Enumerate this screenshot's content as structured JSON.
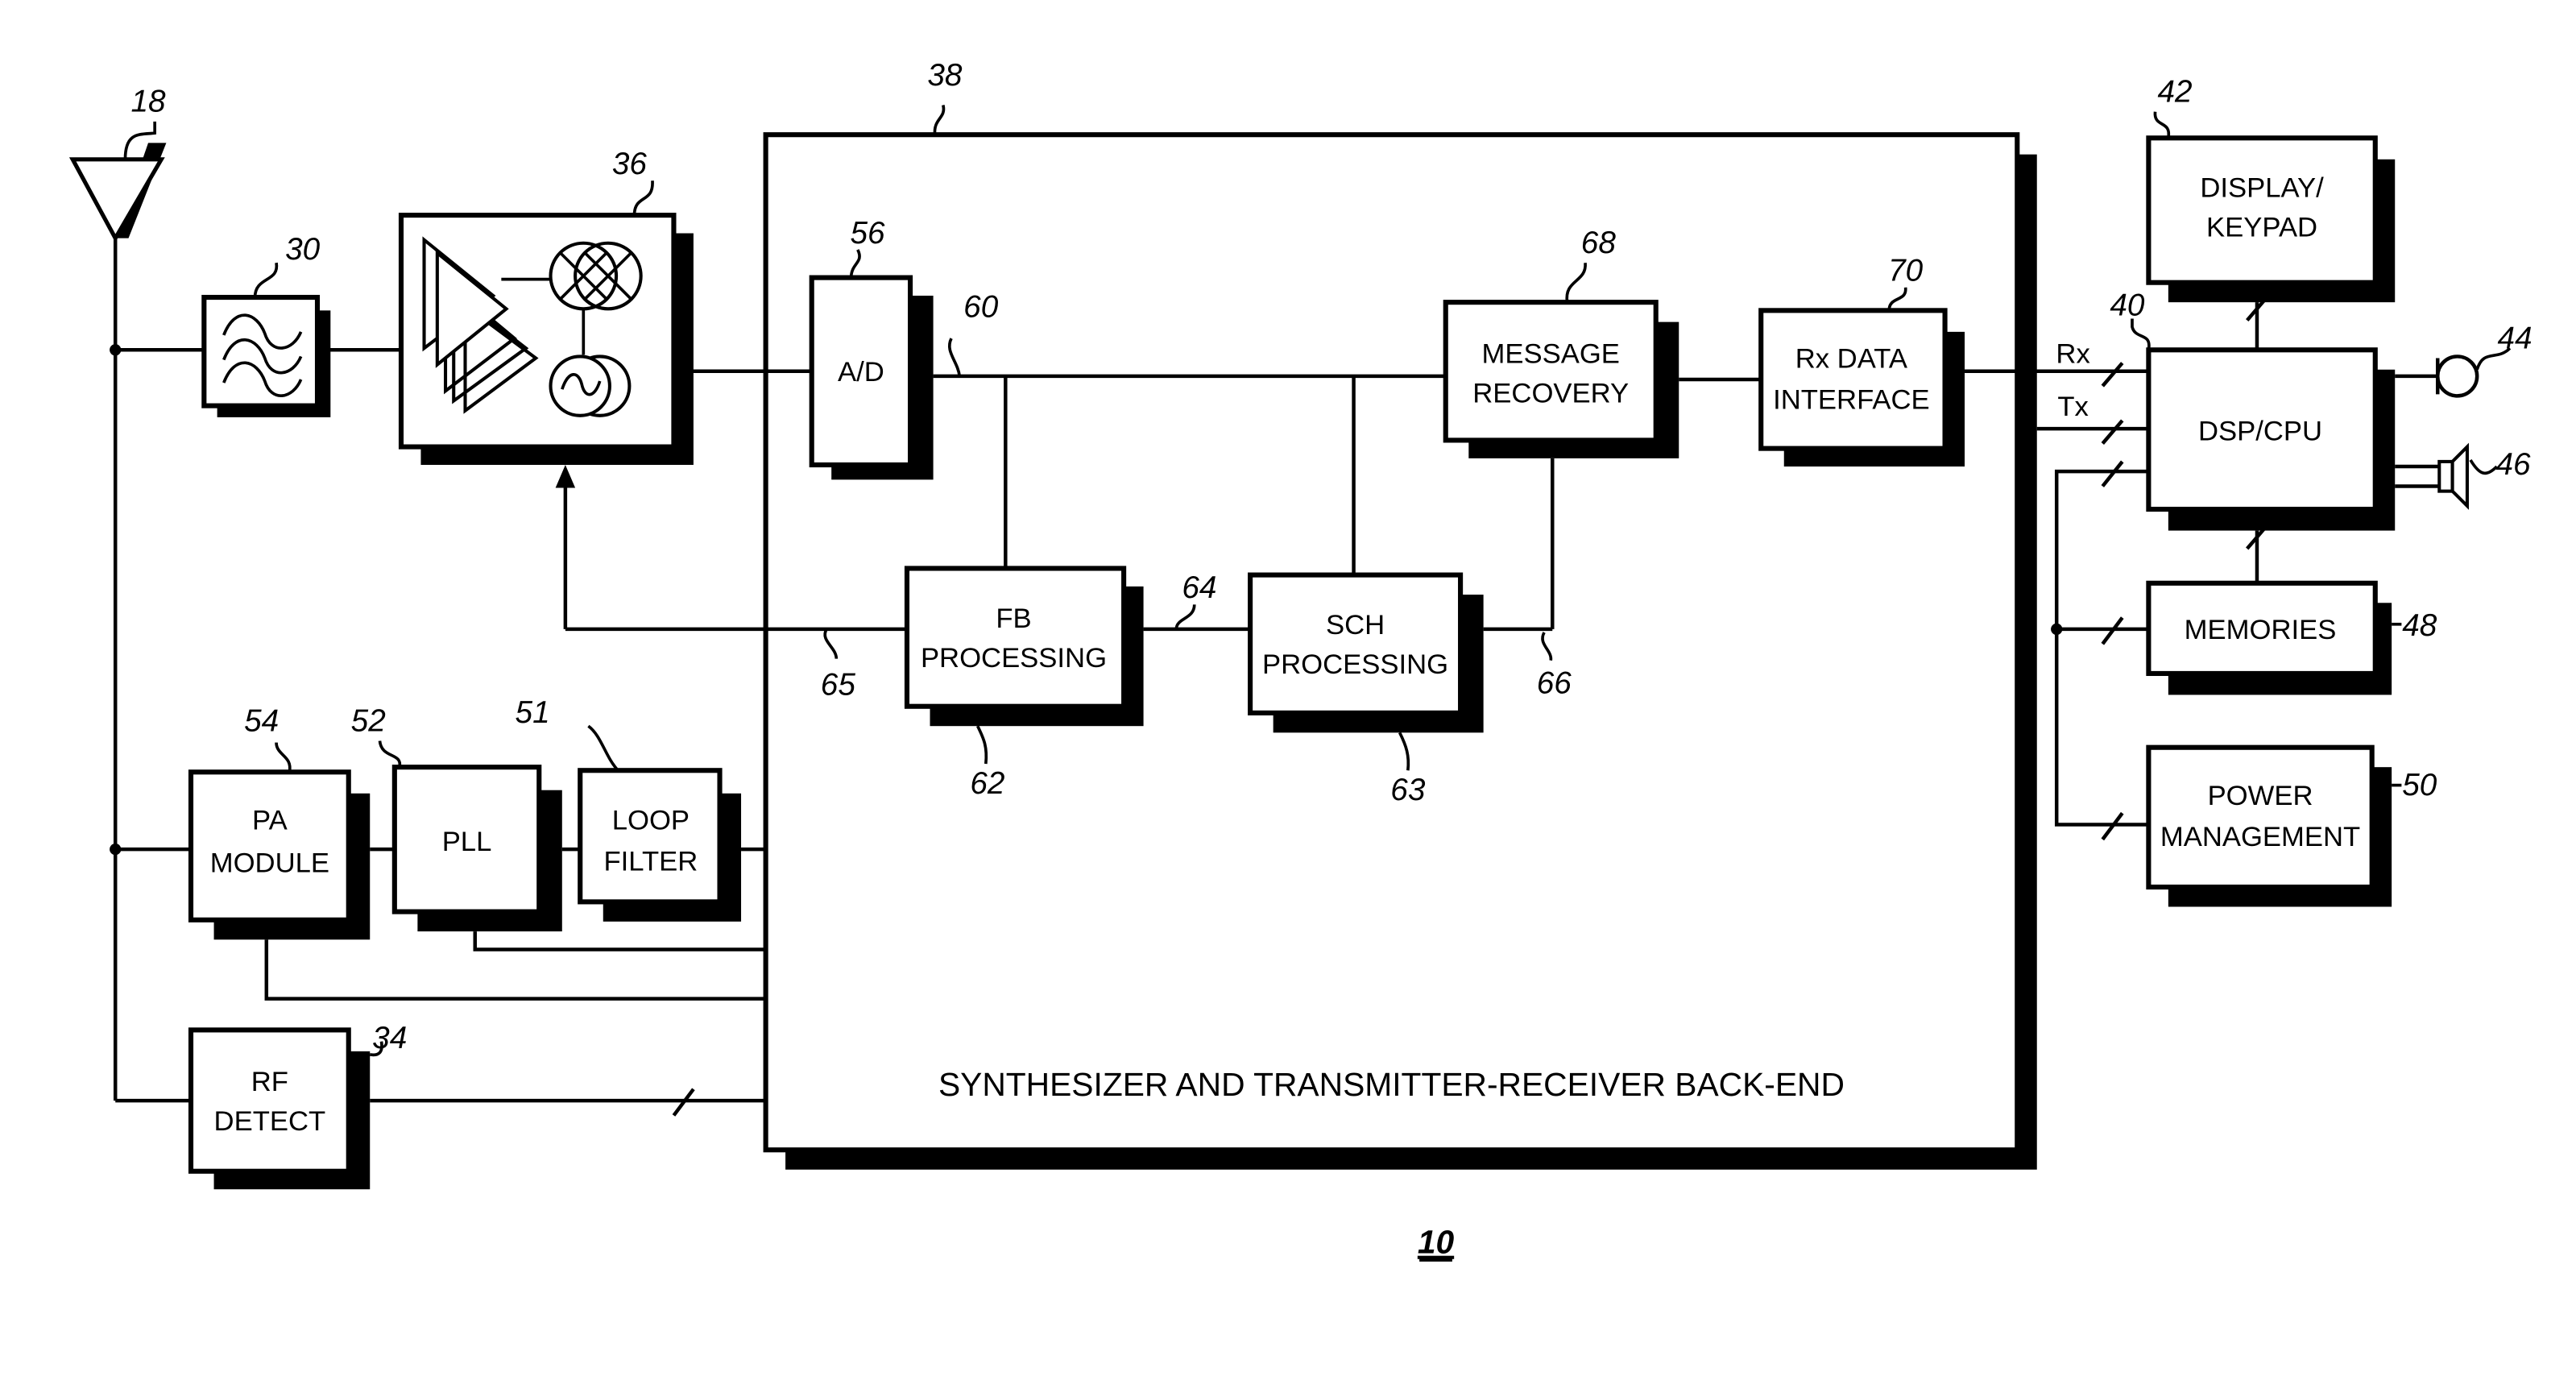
{
  "diagram": {
    "figure_number": "10",
    "colors": {
      "ink": "#000000",
      "background": "#ffffff"
    },
    "blocks": {
      "antenna": {
        "ref": "18",
        "icon": "antenna-icon"
      },
      "filter": {
        "ref": "30",
        "icon": "bandpass-filter-icon"
      },
      "rf_frontend": {
        "ref": "36",
        "icon": "amplifier-mixer-oscillator-icon"
      },
      "backend": {
        "ref": "38",
        "label": "SYNTHESIZER AND TRANSMITTER-RECEIVER BACK-END"
      },
      "adc": {
        "ref": "56",
        "label": "A/D"
      },
      "message_recovery": {
        "ref": "68",
        "line1": "MESSAGE",
        "line2": "RECOVERY"
      },
      "rx_data_interface": {
        "ref": "70",
        "line1": "Rx DATA",
        "line2": "INTERFACE"
      },
      "fb_processing": {
        "ref": "62",
        "line1": "FB",
        "line2": "PROCESSING"
      },
      "sch_processing": {
        "ref": "63",
        "line1": "SCH",
        "line2": "PROCESSING"
      },
      "dsp_cpu": {
        "ref": "40",
        "label": "DSP/CPU"
      },
      "display_keypad": {
        "ref": "42",
        "line1": "DISPLAY/",
        "line2": "KEYPAD"
      },
      "microphone": {
        "ref": "44",
        "icon": "microphone-icon"
      },
      "speaker": {
        "ref": "46",
        "icon": "speaker-icon"
      },
      "memories": {
        "ref": "48",
        "label": "MEMORIES"
      },
      "power_management": {
        "ref": "50",
        "line1": "POWER",
        "line2": "MANAGEMENT"
      },
      "pa_module": {
        "ref": "54",
        "line1": "PA",
        "line2": "MODULE"
      },
      "pll": {
        "ref": "52",
        "label": "PLL"
      },
      "loop_filter": {
        "ref": "51",
        "line1": "LOOP",
        "line2": "FILTER"
      },
      "rf_detect": {
        "ref": "34",
        "line1": "RF",
        "line2": "DETECT"
      }
    },
    "signals": {
      "bus": "60",
      "fb_to_sch": "64",
      "feedback": "65",
      "sch_out": "66",
      "rx": "Rx",
      "tx": "Tx"
    }
  }
}
